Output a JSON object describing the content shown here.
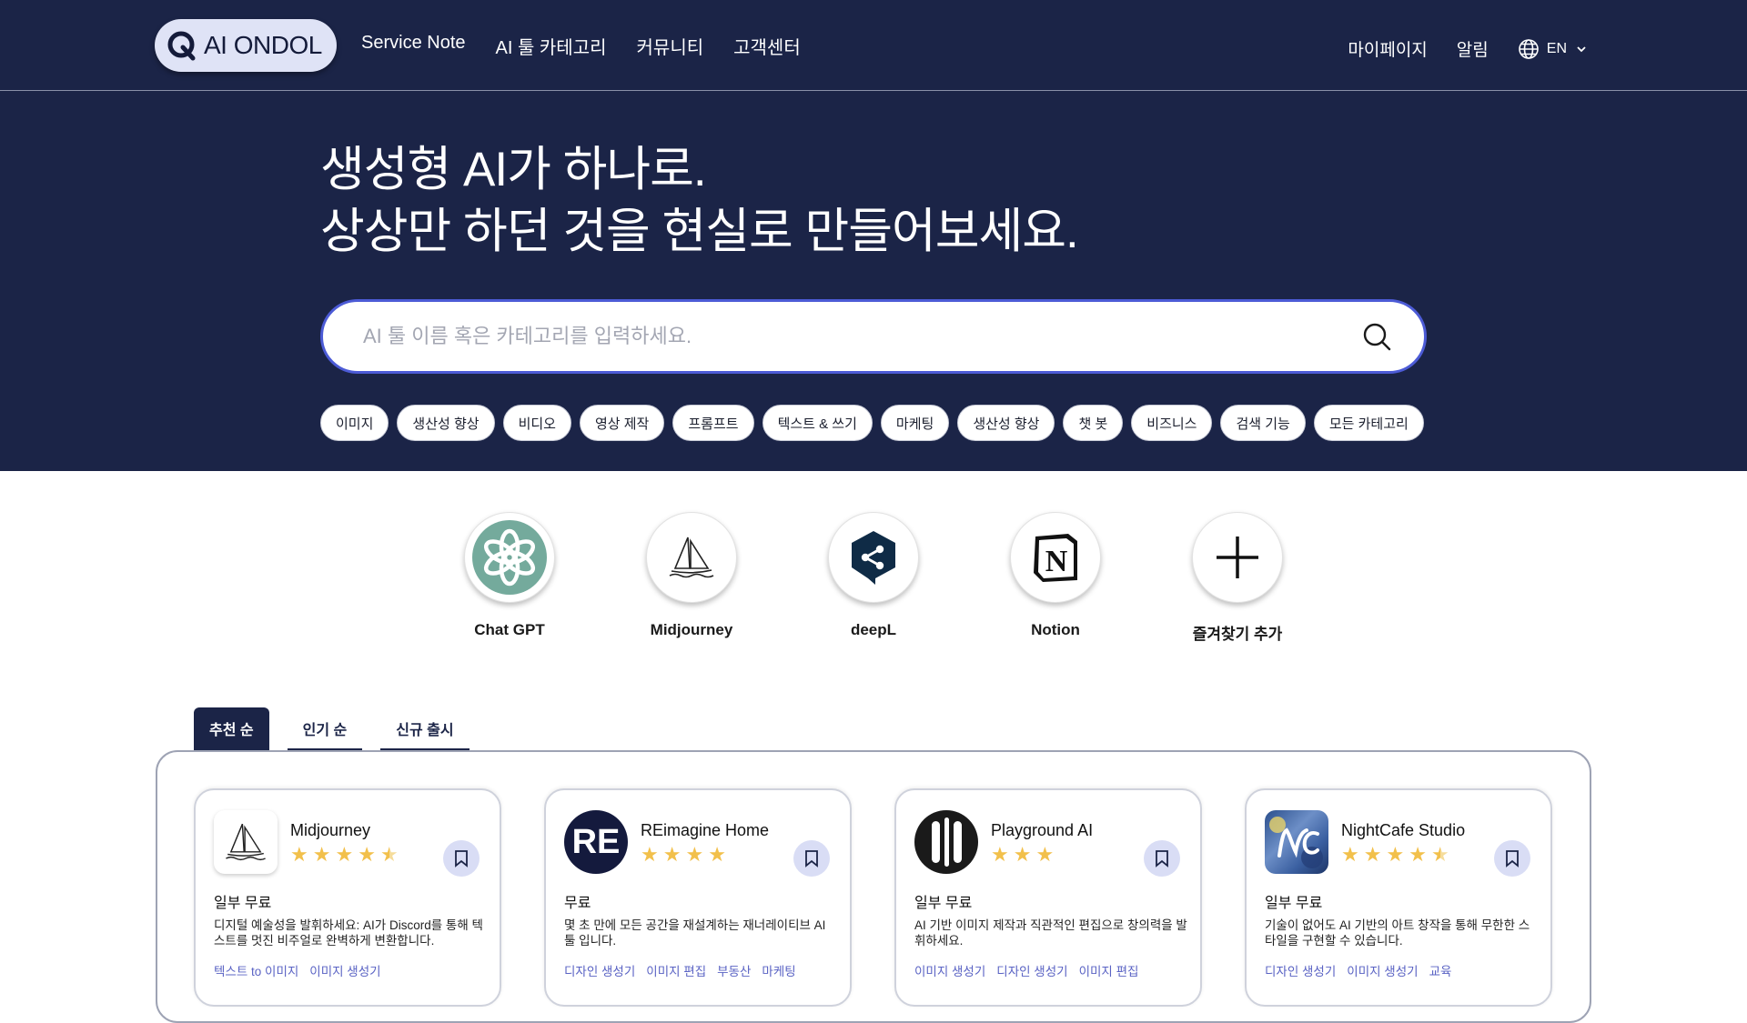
{
  "brand": {
    "name": "AI ONDOL"
  },
  "nav": {
    "links": [
      "Service Note",
      "AI 툴 카테고리",
      "커뮤니티",
      "고객센터"
    ],
    "mypage": "마이페이지",
    "alerts": "알림",
    "language": "EN"
  },
  "hero": {
    "line1": "생성형 AI가 하나로.",
    "line2": "상상만 하던 것을 현실로 만들어보세요.",
    "search_placeholder": "AI 툴 이름 혹은 카테고리를 입력하세요."
  },
  "chips": [
    "이미지",
    "생산성 향상",
    "비디오",
    "영상 제작",
    "프롬프트",
    "텍스트 & 쓰기",
    "마케팅",
    "생산성 향상",
    "챗 봇",
    "비즈니스",
    "검색 기능",
    "모든 카테고리"
  ],
  "favorites": [
    "Chat GPT",
    "Midjourney",
    "deepL",
    "Notion",
    "즐겨찾기 추가"
  ],
  "tabs": [
    "추천 순",
    "인기 순",
    "신규 출시"
  ],
  "cards": [
    {
      "name": "Midjourney",
      "rating": 4.5,
      "price": "일부 무료",
      "desc": "디지털 예술성을 발휘하세요: AI가 Discord를 통해 텍스트를 멋진 비주얼로 완벽하게 변환합니다.",
      "tags": [
        "텍스트 to 이미지",
        "이미지 생성기"
      ]
    },
    {
      "name": "REimagine Home",
      "logo_text": "RE",
      "rating": 4,
      "price": "무료",
      "desc": "몇 초 만에 모든 공간을 재설계하는 재너레이티브 AI 툴 입니다.",
      "tags": [
        "디자인 생성기",
        "이미지 편집",
        "부동산",
        "마케팅"
      ]
    },
    {
      "name": "Playground AI",
      "rating": 3,
      "price": "일부 무료",
      "desc": "AI 기반 이미지 제작과 직관적인 편집으로 창의력을 발휘하세요.",
      "tags": [
        "이미지 생성기",
        "디자인 생성기",
        "이미지 편집"
      ]
    },
    {
      "name": "NightCafe Studio",
      "rating": 4.5,
      "price": "일부 무료",
      "desc": "기술이 없어도 AI 기반의 아트 창작을 통해 무한한 스타일을 구현할 수 있습니다.",
      "tags": [
        "디자인 생성기",
        "이미지 생성기",
        "교육"
      ]
    }
  ],
  "colors": {
    "navy": "#1b2447",
    "accent": "#4c5bd6",
    "star": "#f2c04b",
    "tag": "#5a63c4",
    "chatgpt": "#74aa9c",
    "deepl": "#0f2b46"
  }
}
